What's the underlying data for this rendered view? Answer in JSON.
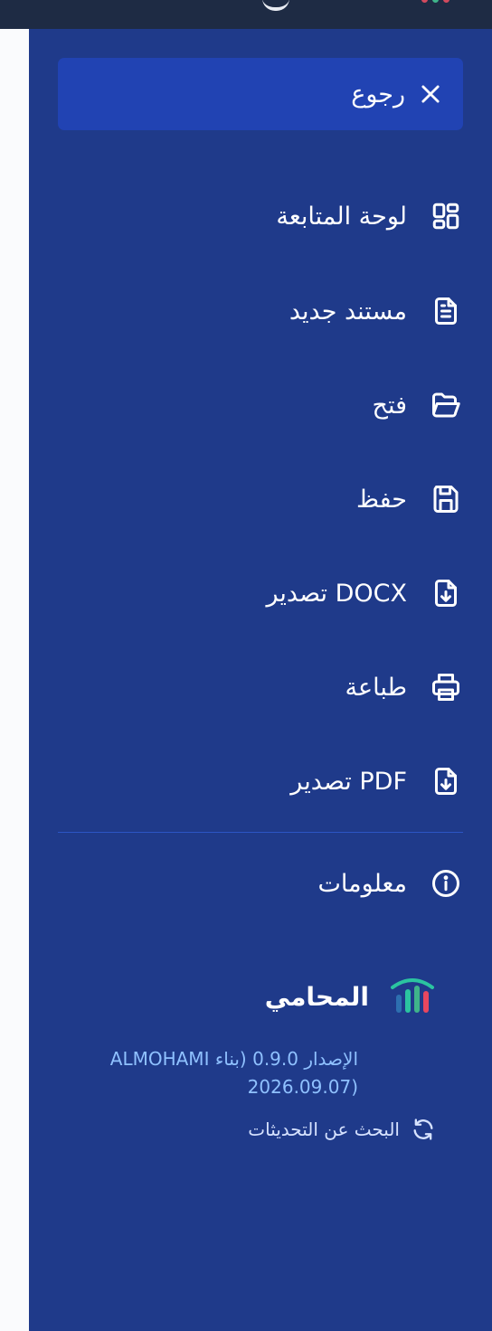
{
  "colors": {
    "panel_bg": "#1f3a8a",
    "back_bg": "#2143b3",
    "text": "#ffffff",
    "version_text": "#8fc1ff",
    "divider": "#2c55c4",
    "logo_green": "#2bc4a0",
    "logo_red": "#e8475f"
  },
  "back": {
    "label": "رجوع",
    "icon": "close-icon"
  },
  "menu": [
    {
      "label": "لوحة المتابعة",
      "icon": "dashboard-grid-icon"
    },
    {
      "label": "مستند جديد",
      "icon": "new-document-icon"
    },
    {
      "label": "فتح",
      "icon": "folder-open-icon"
    },
    {
      "label": "حفظ",
      "icon": "save-icon"
    },
    {
      "label": "تصدير DOCX",
      "icon": "file-download-icon"
    },
    {
      "label": "طباعة",
      "icon": "printer-icon"
    },
    {
      "label": "تصدير PDF",
      "icon": "file-download-icon"
    }
  ],
  "info": {
    "label": "معلومات",
    "icon": "info-icon"
  },
  "brand": {
    "name": "المحامي",
    "icon": "almohami-logo-icon"
  },
  "version": {
    "line1": "الإصدار 0.9.0 (بناء ALMOHAMI",
    "line2": "(2026.09.07"
  },
  "updates": {
    "label": "البحث عن التحديثات",
    "icon": "refresh-icon"
  }
}
